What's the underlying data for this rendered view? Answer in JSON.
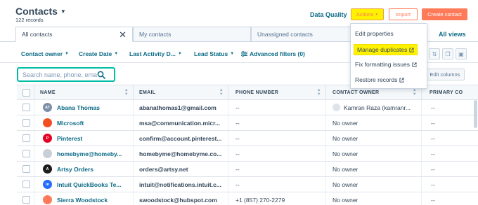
{
  "header": {
    "title": "Contacts",
    "records": "122 records",
    "data_quality": "Data Quality",
    "actions_label": "Actions",
    "import_label": "Import",
    "create_label": "Create contact"
  },
  "tabs": {
    "items": [
      "All contacts",
      "My contacts",
      "Unassigned contacts"
    ],
    "all_views": "All views"
  },
  "filters": [
    "Contact owner",
    "Create Date",
    "Last Activity D...",
    "Lead Status",
    "Advanced filters (0)"
  ],
  "search": {
    "placeholder": "Search name, phone, email"
  },
  "edit_columns": "Edit columns",
  "columns": [
    "NAME",
    "EMAIL",
    "PHONE NUMBER",
    "CONTACT OWNER",
    "PRIMARY CO"
  ],
  "rows": [
    {
      "name": "Abana Thomas",
      "email": "abanathomas1@gmail.com",
      "phone": "--",
      "owner": "Kamran Raza (kamranr...",
      "primary": "--",
      "avatar_text": "AT",
      "avatar_color": "#7b8fa8"
    },
    {
      "name": "Microsoft",
      "email": "msa@communication.micr...",
      "phone": "--",
      "owner": "No owner",
      "primary": "--",
      "avatar_text": "",
      "avatar_color": "#f25022"
    },
    {
      "name": "Pinterest",
      "email": "confirm@account.pinterest...",
      "phone": "--",
      "owner": "No owner",
      "primary": "--",
      "avatar_text": "P",
      "avatar_color": "#e60023"
    },
    {
      "name": "homebyme@homeby...",
      "email": "homebyme@homebyme.co...",
      "phone": "--",
      "owner": "No owner",
      "primary": "--",
      "avatar_text": "",
      "avatar_color": "#c9cfd6"
    },
    {
      "name": "Artsy Orders",
      "email": "orders@artsy.net",
      "phone": "--",
      "owner": "No owner",
      "primary": "--",
      "avatar_text": "A",
      "avatar_color": "#1c1c1c"
    },
    {
      "name": "Intuit QuickBooks Te...",
      "email": "intuit@notifications.intuit.c...",
      "phone": "--",
      "owner": "No owner",
      "primary": "--",
      "avatar_text": "in",
      "avatar_color": "#236cff"
    },
    {
      "name": "Sierra Woodstock",
      "email": "swoodstock@hubspot.com",
      "phone": "+1 (857) 270-2279",
      "owner": "No owner",
      "primary": "--",
      "avatar_text": "",
      "avatar_color": "#ff7a59"
    }
  ],
  "actions_menu": [
    "Edit properties",
    "Manage duplicates",
    "Fix formatting issues",
    "Restore records"
  ],
  "colors": {
    "accent": "#ff7a59",
    "link": "#0b6b86",
    "highlight": "#fff200",
    "focus": "#00bda5"
  }
}
